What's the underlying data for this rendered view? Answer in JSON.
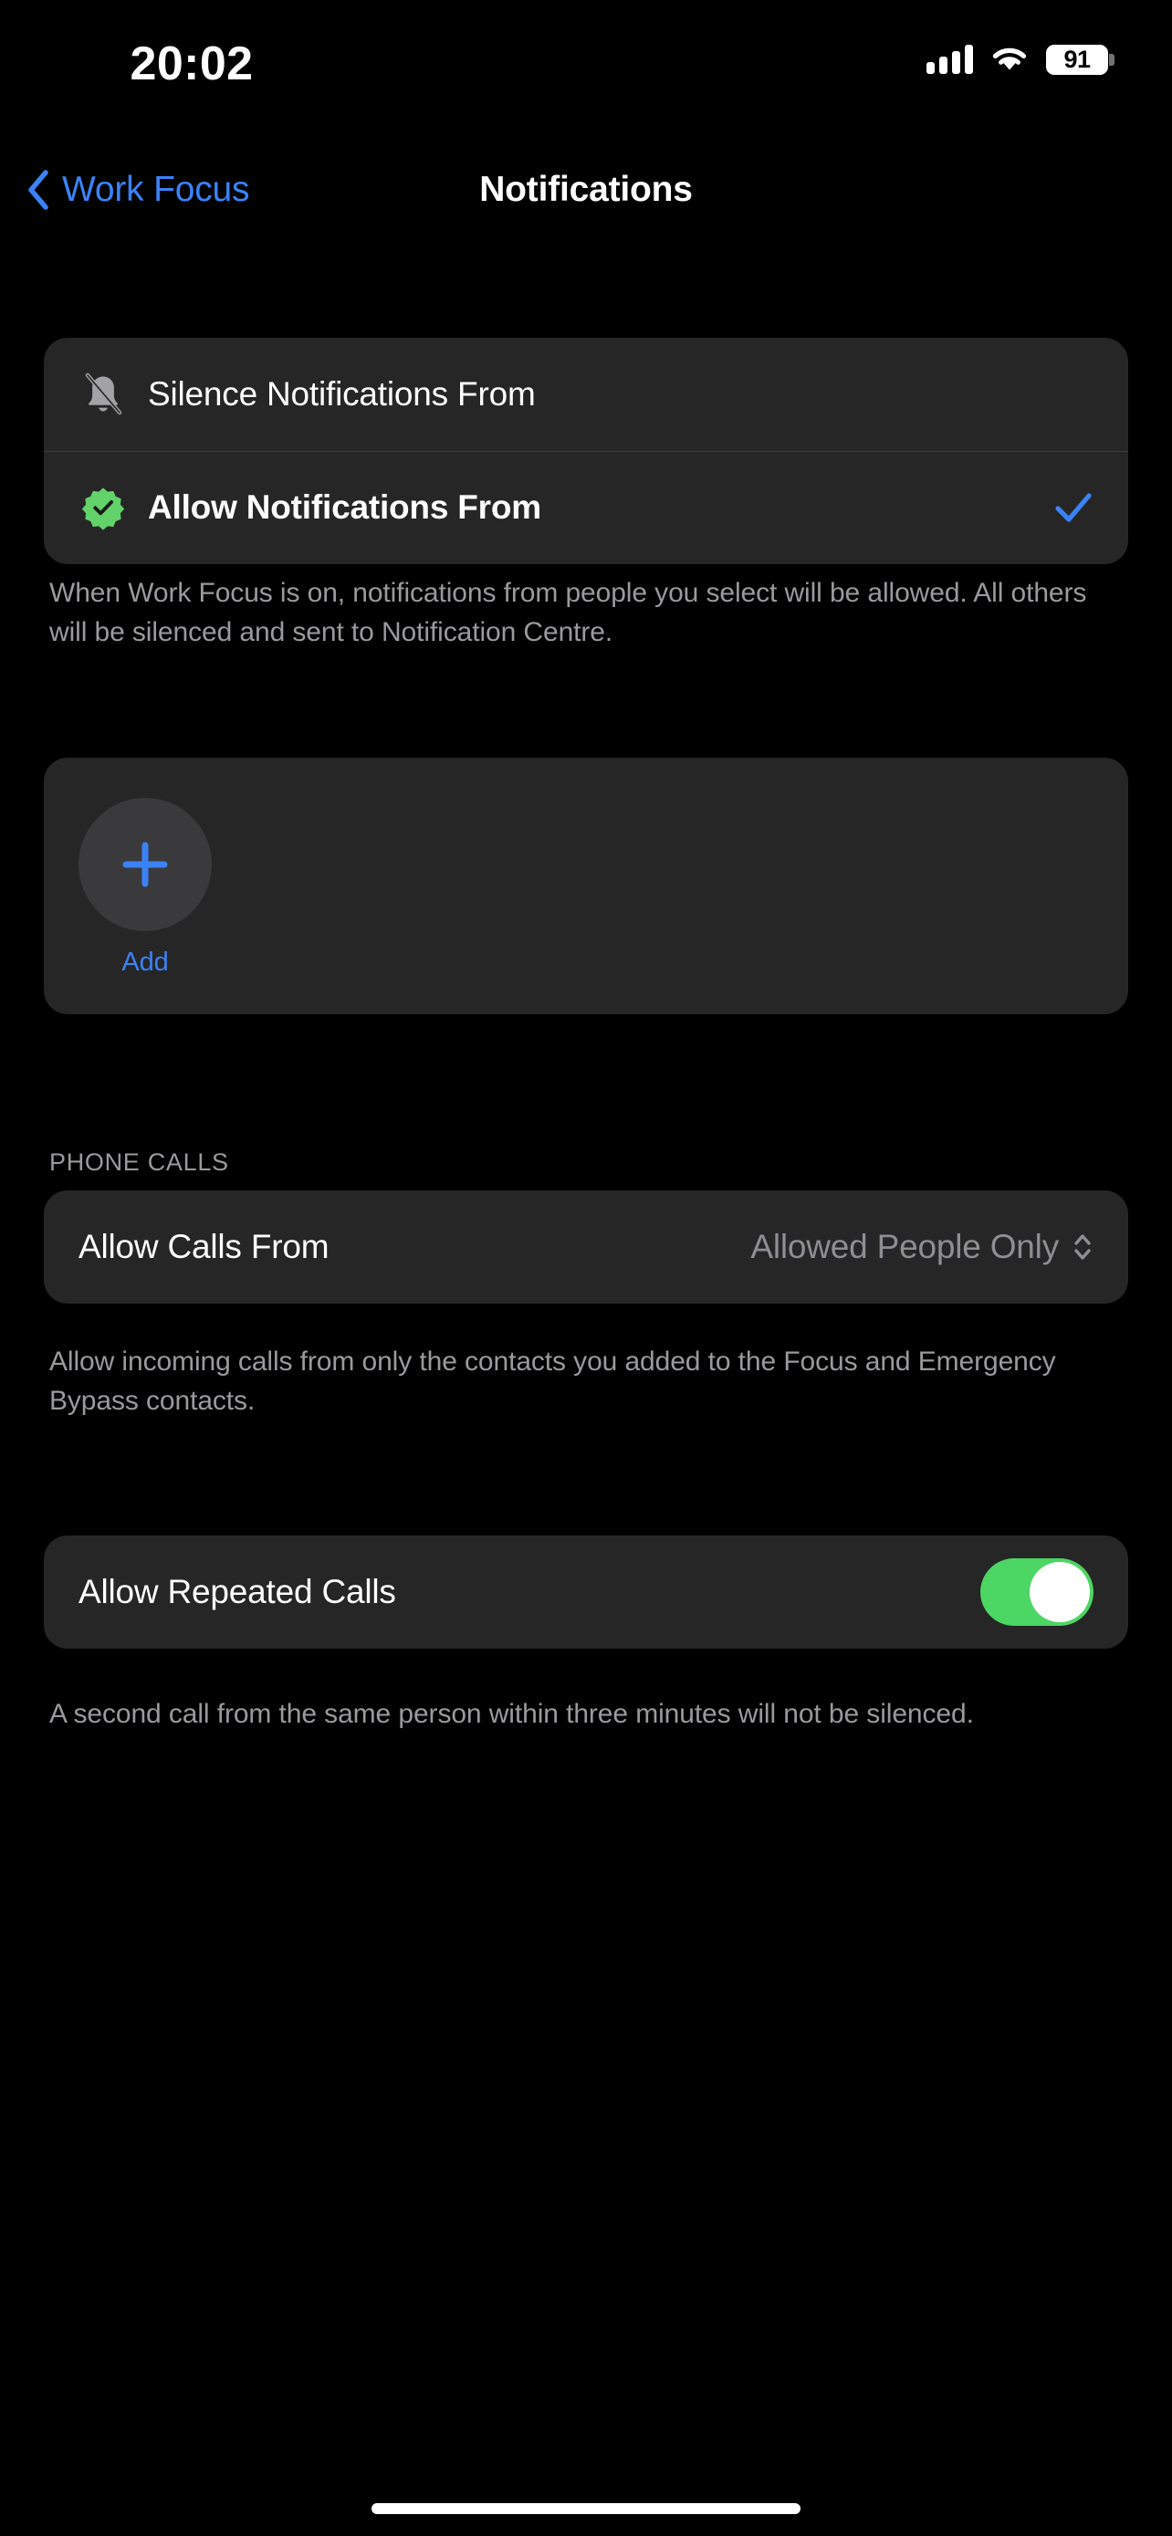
{
  "status_bar": {
    "time": "20:02",
    "battery_level": "91",
    "cellular_icon": "cellular-bars-icon",
    "wifi_icon": "wifi-icon",
    "battery_icon": "battery-icon"
  },
  "nav": {
    "back_label": "Work Focus",
    "back_icon": "chevron-left-icon",
    "title": "Notifications"
  },
  "notification_source": {
    "options": [
      {
        "label": "Silence Notifications From",
        "icon": "bell-slash-icon",
        "selected": false
      },
      {
        "label": "Allow Notifications From",
        "icon": "checkmark-seal-icon",
        "selected": true
      }
    ],
    "footnote": "When Work Focus is on, notifications from people you select will be allowed. All others will be silenced and sent to Notification Centre."
  },
  "people": {
    "add_icon": "plus-icon",
    "add_label": "Add"
  },
  "phone_calls": {
    "header": "PHONE CALLS",
    "allow_calls_from": {
      "label": "Allow Calls From",
      "value": "Allowed People Only",
      "picker_icon": "chevron-up-down-icon"
    },
    "allow_calls_footnote": "Allow incoming calls from only the contacts you added to the Focus and Emergency Bypass contacts.",
    "allow_repeated_calls": {
      "label": "Allow Repeated Calls",
      "enabled": "on"
    },
    "repeated_calls_footnote": "A second call from the same person within three minutes will not be silenced."
  },
  "colors": {
    "background": "#000000",
    "card": "#262626",
    "accent_blue": "#3b82f7",
    "accent_green": "#4cd663",
    "seal_green": "#63d26a",
    "secondary_text": "#9a9a9e",
    "value_text": "#8e8e93"
  },
  "home_indicator": "home-indicator"
}
